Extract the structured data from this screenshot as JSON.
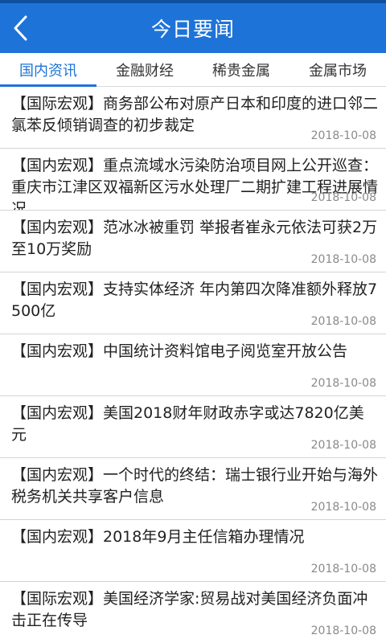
{
  "header": {
    "title": "今日要闻",
    "back_icon": "chevron-left-icon"
  },
  "colors": {
    "header_bg": "#1e73d8",
    "accent": "#1e73d8"
  },
  "tabs": [
    {
      "label": "国内资讯",
      "active": true
    },
    {
      "label": "金融财经",
      "active": false
    },
    {
      "label": "稀贵金属",
      "active": false
    },
    {
      "label": "金属市场",
      "active": false
    }
  ],
  "news": [
    {
      "title": "【国际宏观】商务部公布对原产日本和印度的进口邻二氯苯反倾销调查的初步裁定",
      "date": "2018-10-08"
    },
    {
      "title": "【国内宏观】重点流域水污染防治项目网上公开巡查：重庆市江津区双福新区污水处理厂二期扩建工程进展情况",
      "date": "2018-10-08"
    },
    {
      "title": "【国内宏观】范冰冰被重罚 举报者崔永元依法可获2万至10万奖励",
      "date": "2018-10-08"
    },
    {
      "title": "【国内宏观】支持实体经济 年内第四次降准额外释放7500亿",
      "date": "2018-10-08"
    },
    {
      "title": "【国内宏观】中国统计资料馆电子阅览室开放公告",
      "date": "2018-10-08"
    },
    {
      "title": "【国内宏观】美国2018财年财政赤字或达7820亿美元",
      "date": "2018-10-08"
    },
    {
      "title": "【国内宏观】一个时代的终结：瑞士银行业开始与海外税务机关共享客户信息",
      "date": "2018-10-08"
    },
    {
      "title": "【国内宏观】2018年9月主任信箱办理情况",
      "date": "2018-10-08"
    },
    {
      "title": "【国际宏观】美国经济学家:贸易战对美国经济负面冲击正在传导",
      "date": "2018-10-08"
    }
  ]
}
